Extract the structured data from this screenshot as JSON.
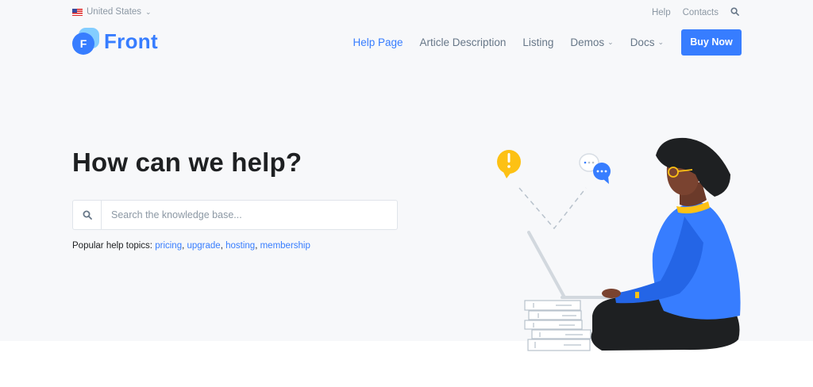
{
  "topbar": {
    "region": "United States",
    "links": [
      "Help",
      "Contacts"
    ]
  },
  "brand": {
    "logo_letter": "F",
    "name": "Front"
  },
  "nav": {
    "items": [
      {
        "label": "Help Page"
      },
      {
        "label": "Article Description"
      },
      {
        "label": "Listing"
      },
      {
        "label": "Demos"
      },
      {
        "label": "Docs"
      }
    ],
    "cta": "Buy Now"
  },
  "hero": {
    "title": "How can we help?",
    "search_placeholder": "Search the knowledge base...",
    "topics_label": "Popular help topics:",
    "topics": [
      "pricing",
      "upgrade",
      "hosting",
      "membership"
    ]
  },
  "colors": {
    "primary": "#377dff",
    "hero_bg": "#f7f8fa",
    "muted_text": "#8c98a4",
    "heading": "#1e2022",
    "warning": "#fdc114"
  },
  "icons": {
    "region_flag": "us-flag-icon",
    "top_search": "search-icon",
    "search_field": "search-icon",
    "illustration_alert": "exclamation-bubble-icon",
    "illustration_chat": "chat-bubbles-icon"
  }
}
